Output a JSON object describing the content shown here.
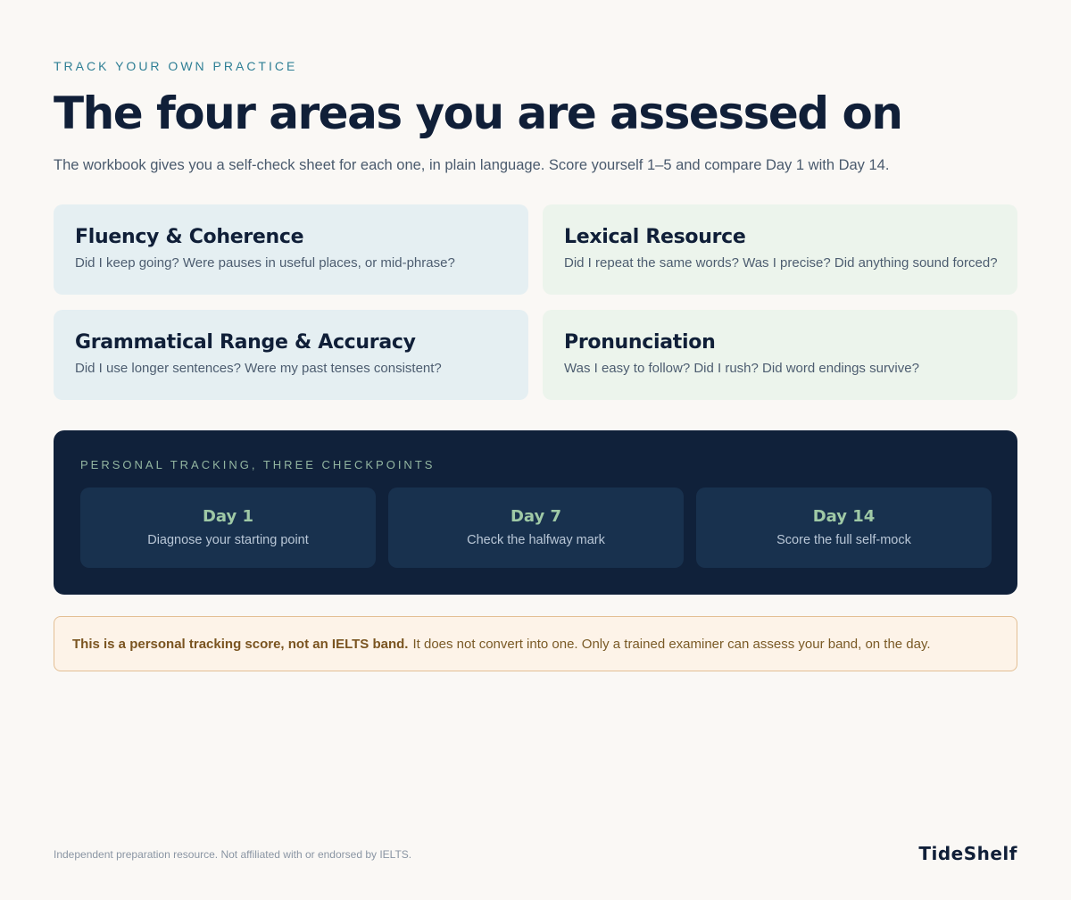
{
  "header": {
    "eyebrow": "TRACK YOUR OWN PRACTICE",
    "title": "The four areas you are assessed on",
    "lede": "The workbook gives you a self-check sheet for each one, in plain language. Score yourself 1–5 and compare Day 1 with Day 14."
  },
  "areas": [
    {
      "title": "Fluency & Coherence",
      "text": "Did I keep going? Were pauses in useful places, or mid-phrase?"
    },
    {
      "title": "Lexical Resource",
      "text": "Did I repeat the same words? Was I precise? Did anything sound forced?"
    },
    {
      "title": "Grammatical Range & Accuracy",
      "text": "Did I use longer sentences? Were my past tenses consistent?"
    },
    {
      "title": "Pronunciation",
      "text": "Was I easy to follow? Did I rush? Did word endings survive?"
    }
  ],
  "tracking": {
    "label": "PERSONAL TRACKING, THREE CHECKPOINTS",
    "checkpoints": [
      {
        "day": "Day 1",
        "text": "Diagnose your starting point"
      },
      {
        "day": "Day 7",
        "text": "Check the halfway mark"
      },
      {
        "day": "Day 14",
        "text": "Score the full self-mock"
      }
    ]
  },
  "notice": {
    "bold": "This is a personal tracking score, not an IELTS band.",
    "text": "It does not convert into one. Only a trained examiner can assess your band, on the day."
  },
  "footer": {
    "disclaimer": "Independent preparation resource. Not affiliated with or endorsed by IELTS.",
    "brand": "TideShelf"
  }
}
